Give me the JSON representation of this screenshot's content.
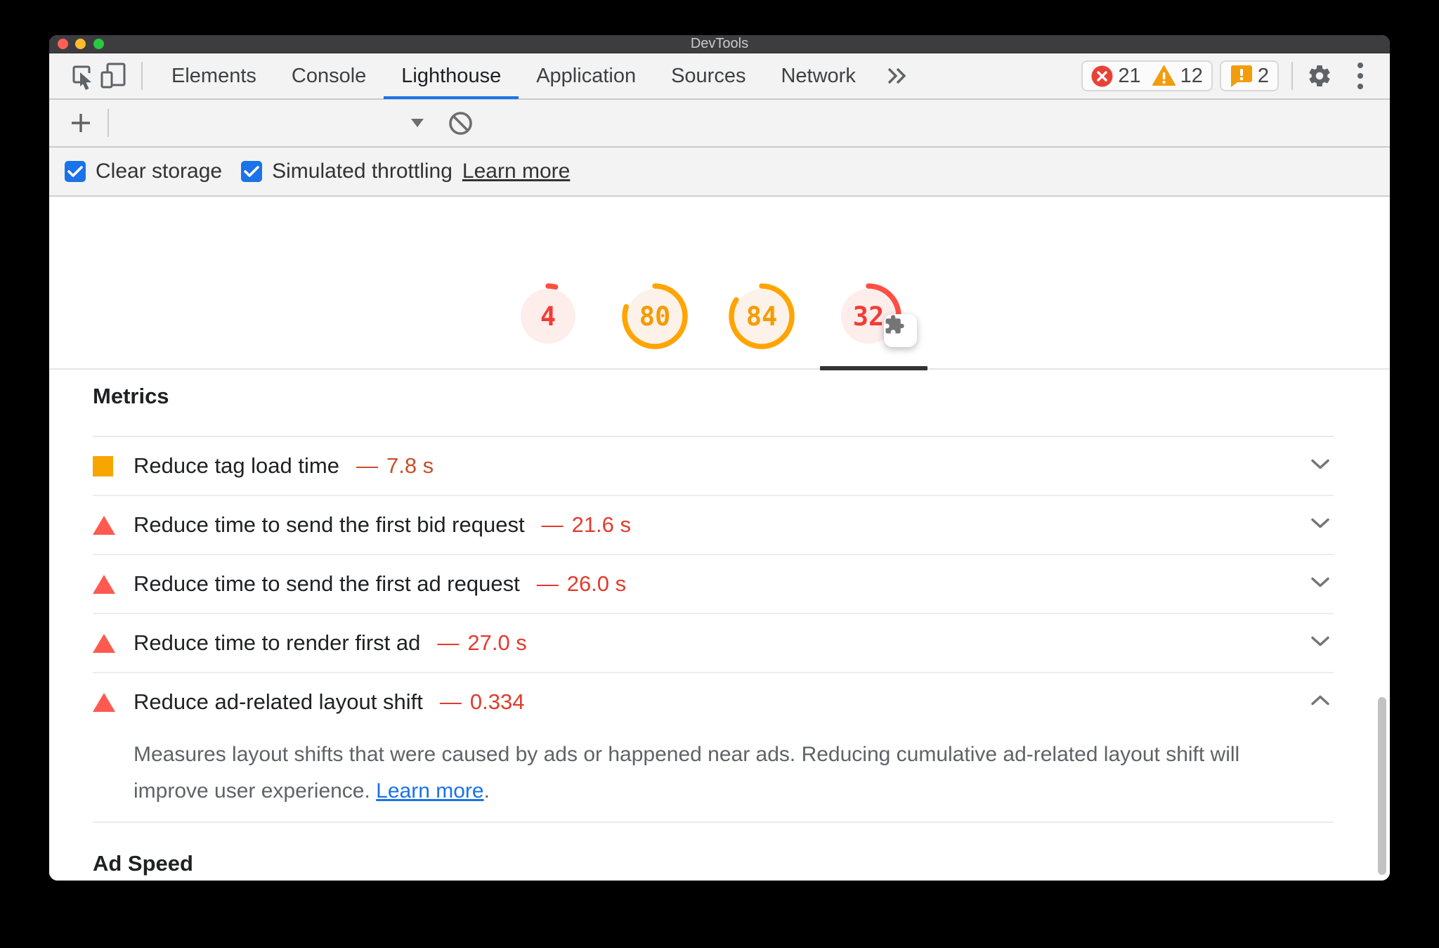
{
  "window": {
    "title": "DevTools"
  },
  "tabs": [
    {
      "label": "Elements",
      "active": false
    },
    {
      "label": "Console",
      "active": false
    },
    {
      "label": "Lighthouse",
      "active": true
    },
    {
      "label": "Application",
      "active": false
    },
    {
      "label": "Sources",
      "active": false
    },
    {
      "label": "Network",
      "active": false
    }
  ],
  "status": {
    "errors": "21",
    "warnings": "12",
    "issues": "2"
  },
  "checkbox_row": {
    "clear_storage": "Clear storage",
    "simulated_throttling": "Simulated throttling",
    "learn_more": "Learn more"
  },
  "gauges": [
    {
      "value": "4",
      "pct": 4,
      "status": "red"
    },
    {
      "value": "80",
      "pct": 80,
      "status": "orange"
    },
    {
      "value": "84",
      "pct": 84,
      "status": "orange"
    },
    {
      "value": "32",
      "pct": 32,
      "status": "red",
      "plugin_badge": true
    }
  ],
  "metrics": {
    "heading": "Metrics",
    "value_separator": "—",
    "rows": [
      {
        "icon": "square-orange",
        "title": "Reduce tag load time",
        "value": "7.8 s",
        "severity": "average",
        "expanded": false
      },
      {
        "icon": "triangle-red",
        "title": "Reduce time to send the first bid request",
        "value": "21.6 s",
        "severity": "fail",
        "expanded": false
      },
      {
        "icon": "triangle-red",
        "title": "Reduce time to send the first ad request",
        "value": "26.0 s",
        "severity": "fail",
        "expanded": false
      },
      {
        "icon": "triangle-red",
        "title": "Reduce time to render first ad",
        "value": "27.0 s",
        "severity": "fail",
        "expanded": false
      },
      {
        "icon": "triangle-red",
        "title": "Reduce ad-related layout shift",
        "value": "0.334",
        "severity": "fail",
        "expanded": true
      }
    ],
    "expanded_description": {
      "text": "Measures layout shifts that were caused by ads or happened near ads. Reducing cumulative ad-related layout shift will improve user experience. ",
      "link_label": "Learn more",
      "suffix": "."
    }
  },
  "sections": {
    "ad_speed": "Ad Speed"
  },
  "colors": {
    "accent_blue": "#1a73e8",
    "error_red": "#e94235",
    "warning_orange": "#f29d0d",
    "gauge_red": "#ff4e42",
    "gauge_orange": "#ffa400",
    "gauge_red_fill": "#fdeeec",
    "gauge_orange_fill": "#fdf2e9",
    "value_fail_red": "#e33a2e",
    "value_average_orange": "#c6502b",
    "metric_square_orange": "#f7a500",
    "metric_triangle_red": "#ff5a50",
    "titlebar_bg": "#3d3d3f",
    "toolbar_bg": "#f3f3f3"
  }
}
